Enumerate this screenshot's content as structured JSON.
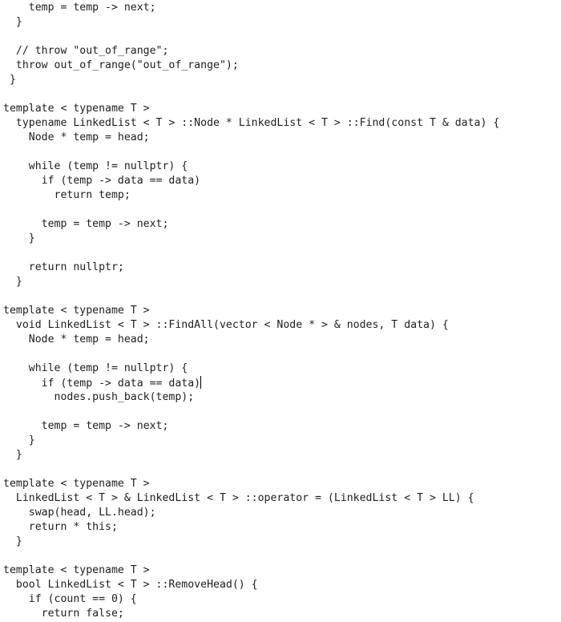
{
  "editor": {
    "lines": [
      "    temp = temp -> next;",
      "  }",
      "",
      "  // throw \"out_of_range\";",
      "  throw out_of_range(\"out_of_range\");",
      " }",
      "",
      "template < typename T >",
      "  typename LinkedList < T > ::Node * LinkedList < T > ::Find(const T & data) {",
      "    Node * temp = head;",
      "",
      "    while (temp != nullptr) {",
      "      if (temp -> data == data)",
      "        return temp;",
      "",
      "      temp = temp -> next;",
      "    }",
      "",
      "    return nullptr;",
      "  }",
      "",
      "template < typename T >",
      "  void LinkedList < T > ::FindAll(vector < Node * > & nodes, T data) {",
      "    Node * temp = head;",
      "",
      "    while (temp != nullptr) {",
      "      if (temp -> data == data)",
      "        nodes.push_back(temp);",
      "",
      "      temp = temp -> next;",
      "    }",
      "  }",
      "",
      "template < typename T >",
      "  LinkedList < T > & LinkedList < T > ::operator = (LinkedList < T > LL) {",
      "    swap(head, LL.head);",
      "    return * this;",
      "  }",
      "",
      "template < typename T >",
      "  bool LinkedList < T > ::RemoveHead() {",
      "    if (count == 0) {",
      "      return false;"
    ],
    "caret_line": 26
  }
}
